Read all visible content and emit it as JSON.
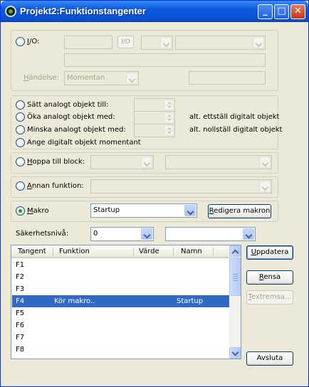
{
  "window": {
    "title": "Projekt2:Funktionstangenter",
    "minimize_icon": "minimize-icon",
    "maximize_icon": "maximize-icon",
    "close_icon": "close-icon"
  },
  "io_group": {
    "io_label": "I/O:",
    "io_button": "I/O",
    "event_label": "Händelse:",
    "event_value": "Momentan"
  },
  "analog_group": {
    "set_label": "Sätt analogt objekt till:",
    "inc_label": "Öka analogt objekt med:",
    "dec_label": "Minska analogt objekt med:",
    "momentary_label": "Ange digitalt objekt momentant",
    "alt_set": "alt. ettställ digitalt objekt",
    "alt_reset": "alt. nollställ digitalt objekt"
  },
  "goto_block": {
    "label": "Hoppa till block:"
  },
  "other_function": {
    "label": "Annan funktion:"
  },
  "macro": {
    "label": "Makro",
    "value": "Startup",
    "edit_button": "Redigera makron"
  },
  "security": {
    "label": "Säkerhetsnivå:",
    "level_value": "0",
    "second_value": ""
  },
  "table": {
    "headers": [
      "Tangent",
      "Funktion",
      "Värde",
      "Namn"
    ],
    "rows": [
      {
        "key": "F1",
        "function": "",
        "value": "",
        "name": ""
      },
      {
        "key": "F2",
        "function": "",
        "value": "",
        "name": ""
      },
      {
        "key": "F3",
        "function": "",
        "value": "",
        "name": ""
      },
      {
        "key": "F4",
        "function": "Kör makro..",
        "value": "",
        "name": "Startup"
      },
      {
        "key": "F5",
        "function": "",
        "value": "",
        "name": ""
      },
      {
        "key": "F6",
        "function": "",
        "value": "",
        "name": ""
      },
      {
        "key": "F7",
        "function": "",
        "value": "",
        "name": ""
      },
      {
        "key": "F8",
        "function": "",
        "value": "",
        "name": ""
      }
    ],
    "selected_key": "F4"
  },
  "buttons": {
    "update": "Uppdatera",
    "clear": "Rensa",
    "text_strip": "Textremsa...",
    "close": "Avsluta"
  },
  "colors": {
    "title_bar": "#0a5ae0",
    "selection": "#316ac5",
    "window_bg": "#ece9d8",
    "radio_dot": "#21a121"
  }
}
